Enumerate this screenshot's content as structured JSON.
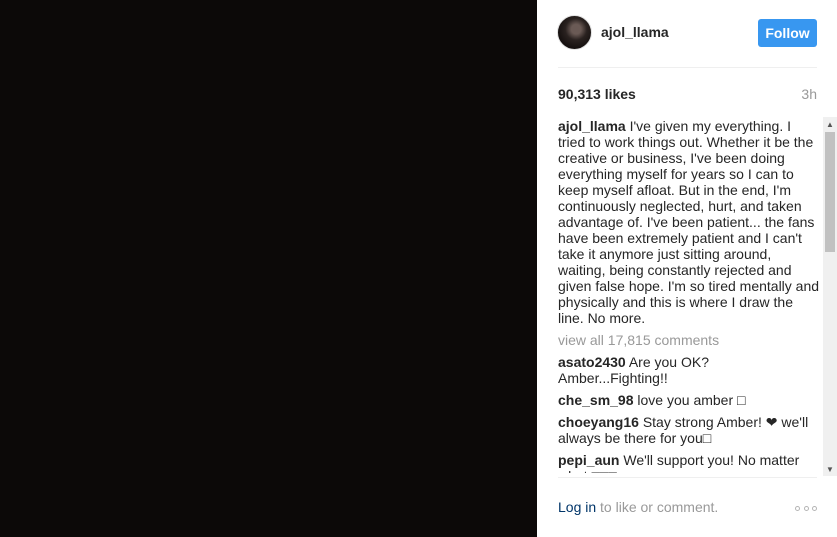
{
  "post": {
    "username": "ajol_llama",
    "follow_label": "Follow",
    "likes": "90,313 likes",
    "time": "3h"
  },
  "caption": {
    "username": "ajol_llama",
    "text": "I've given my everything. I tried to work things out. Whether it be the creative or business, I've been doing everything myself for years so I can to keep myself afloat. But in the end, I'm continuously neglected, hurt, and taken advantage of. I've been patient... the fans have been extremely patient and I can't take it anymore just sitting around, waiting, being constantly rejected and given false hope. I'm so tired mentally and physically and this is where I draw the line. No more."
  },
  "view_all": "view all 17,815 comments",
  "comments": [
    {
      "username": "asato2430",
      "text": "Are you OK? Amber...Fighting!!"
    },
    {
      "username": "che_sm_98",
      "text": "love you amber □"
    },
    {
      "username": "choeyang16",
      "text": "Stay strong Amber! ❤ we'll always be there for you□"
    },
    {
      "username": "pepi_aun",
      "text": "We'll support you! No matter what □□□"
    }
  ],
  "footer": {
    "login_link": "Log in",
    "login_text": " to like or comment."
  },
  "colors": {
    "follow_bg": "#3897f0",
    "link": "#003569",
    "muted": "#999999"
  }
}
